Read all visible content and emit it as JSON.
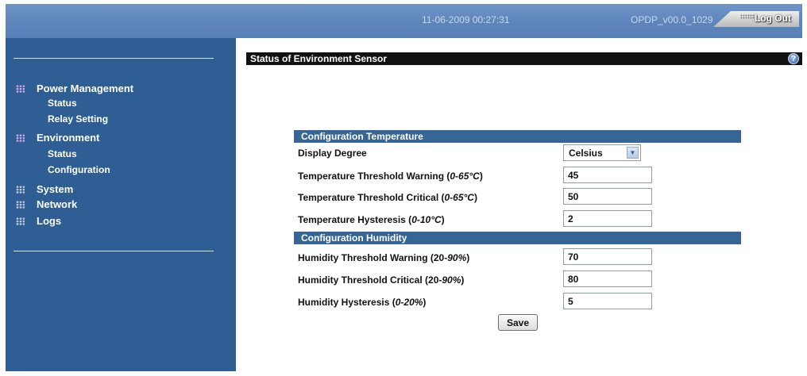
{
  "header": {
    "datetime": "11-06-2009 00:27:31",
    "version": "OPDP_v00.0_1029",
    "logout_label": "Log Out"
  },
  "sidebar": {
    "power_management": {
      "label": "Power Management",
      "items": [
        {
          "label": "Status"
        },
        {
          "label": "Relay Setting"
        }
      ]
    },
    "environment": {
      "label": "Environment",
      "items": [
        {
          "label": "Status"
        },
        {
          "label": "Configuration"
        }
      ]
    },
    "system": {
      "label": "System"
    },
    "network": {
      "label": "Network"
    },
    "logs": {
      "label": "Logs"
    }
  },
  "main": {
    "title": "Status of Environment Sensor",
    "help_icon": "?",
    "temperature": {
      "heading": "Configuration Temperature",
      "display_degree_label": "Display Degree",
      "display_degree_value": "Celsius",
      "warning": {
        "label": "Temperature Threshold Warning (",
        "range": "0-65°C",
        "close": ")",
        "value": "45"
      },
      "critical": {
        "label": "Temperature Threshold Critical (",
        "range": "0-65°C",
        "close": ")",
        "value": "50"
      },
      "hysteresis": {
        "label": "Temperature Hysteresis (",
        "range": "0-10°C",
        "close": ")",
        "value": "2"
      }
    },
    "humidity": {
      "heading": "Configuration Humidity",
      "warning": {
        "label": "Humidity Threshold Warning (20-",
        "range": "90%",
        "close": ")",
        "value": "70"
      },
      "critical": {
        "label": "Humidity Threshold Critical (20-",
        "range": "90%",
        "close": ")",
        "value": "80"
      },
      "hysteresis": {
        "label": "Humidity Hysteresis (",
        "range": "0-20%",
        "close": ")",
        "value": "5"
      }
    },
    "save_label": "Save"
  },
  "icons": {
    "nav": "grid-dots-icon",
    "help": "help-icon",
    "dropdown": "chevron-down-icon"
  },
  "colors": {
    "topbar": "#5e85bb",
    "sidebar": "#2e5e93",
    "section_bar": "#376596",
    "title_bar": "#111111"
  }
}
